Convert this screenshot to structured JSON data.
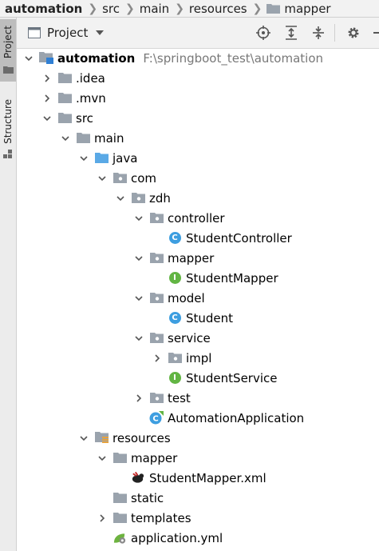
{
  "breadcrumb": [
    {
      "label": "automation",
      "bold": true
    },
    {
      "label": "src"
    },
    {
      "label": "main"
    },
    {
      "label": "resources"
    },
    {
      "label": "mapper",
      "icon": "folder-icon"
    }
  ],
  "side_tabs": {
    "project": "Project",
    "structure": "Structure"
  },
  "toolwindow": {
    "title": "Project"
  },
  "tree": [
    {
      "label": "automation",
      "depth": 0,
      "arrow": "down",
      "icon": "module-folder-icon",
      "bold": true,
      "path": "F:\\springboot_test\\automation"
    },
    {
      "label": ".idea",
      "depth": 1,
      "arrow": "right",
      "icon": "folder-icon"
    },
    {
      "label": ".mvn",
      "depth": 1,
      "arrow": "right",
      "icon": "folder-icon"
    },
    {
      "label": "src",
      "depth": 1,
      "arrow": "down",
      "icon": "folder-icon"
    },
    {
      "label": "main",
      "depth": 2,
      "arrow": "down",
      "icon": "folder-icon"
    },
    {
      "label": "java",
      "depth": 3,
      "arrow": "down",
      "icon": "source-folder-icon"
    },
    {
      "label": "com",
      "depth": 4,
      "arrow": "down",
      "icon": "package-icon"
    },
    {
      "label": "zdh",
      "depth": 5,
      "arrow": "down",
      "icon": "package-icon"
    },
    {
      "label": "controller",
      "depth": 6,
      "arrow": "down",
      "icon": "package-icon"
    },
    {
      "label": "StudentController",
      "depth": 7,
      "arrow": "none",
      "icon": "class-icon"
    },
    {
      "label": "mapper",
      "depth": 6,
      "arrow": "down",
      "icon": "package-icon"
    },
    {
      "label": "StudentMapper",
      "depth": 7,
      "arrow": "none",
      "icon": "interface-icon"
    },
    {
      "label": "model",
      "depth": 6,
      "arrow": "down",
      "icon": "package-icon"
    },
    {
      "label": "Student",
      "depth": 7,
      "arrow": "none",
      "icon": "class-icon"
    },
    {
      "label": "service",
      "depth": 6,
      "arrow": "down",
      "icon": "package-icon"
    },
    {
      "label": "impl",
      "depth": 7,
      "arrow": "right",
      "icon": "package-icon"
    },
    {
      "label": "StudentService",
      "depth": 7,
      "arrow": "none",
      "icon": "interface-icon"
    },
    {
      "label": "test",
      "depth": 6,
      "arrow": "right",
      "icon": "package-icon"
    },
    {
      "label": "AutomationApplication",
      "depth": 6,
      "arrow": "none",
      "icon": "spring-boot-class-icon"
    },
    {
      "label": "resources",
      "depth": 3,
      "arrow": "down",
      "icon": "resources-folder-icon"
    },
    {
      "label": "mapper",
      "depth": 4,
      "arrow": "down",
      "icon": "folder-icon"
    },
    {
      "label": "StudentMapper.xml",
      "depth": 5,
      "arrow": "none",
      "icon": "mybatis-xml-icon"
    },
    {
      "label": "static",
      "depth": 4,
      "arrow": "none",
      "icon": "folder-icon"
    },
    {
      "label": "templates",
      "depth": 4,
      "arrow": "right",
      "icon": "folder-icon"
    },
    {
      "label": "application.yml",
      "depth": 4,
      "arrow": "none",
      "icon": "spring-yml-icon"
    }
  ],
  "colors": {
    "folder": "#9aa3ad",
    "source_folder": "#5aa9e6",
    "class_badge": "#3d9ee0",
    "interface_badge": "#62b543"
  }
}
